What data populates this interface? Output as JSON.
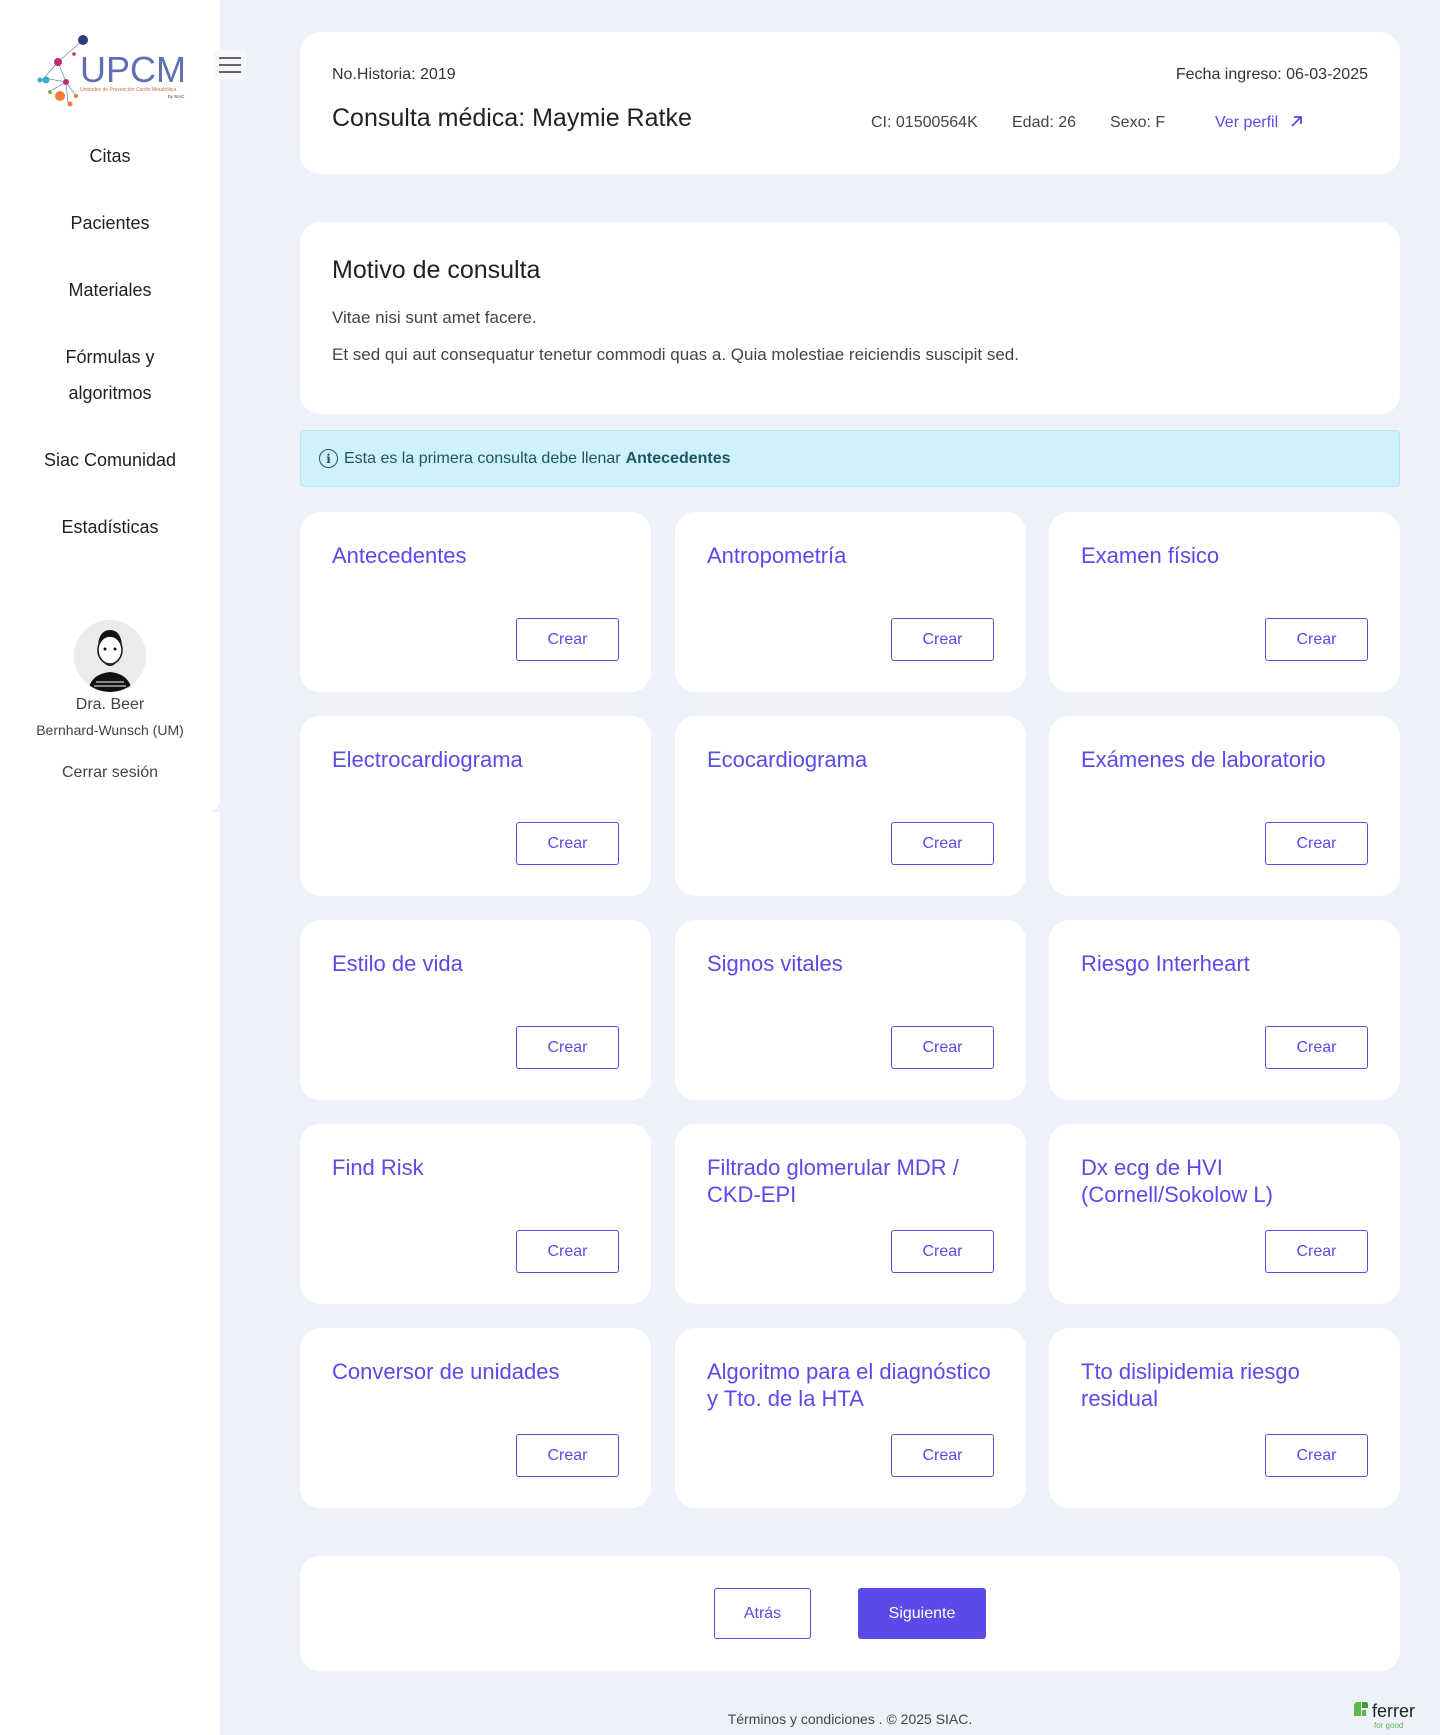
{
  "brand": {
    "logo_text": "UPCM",
    "logo_subtitle": "Unidades de Prevención Cardio Metabólica",
    "logo_tag": "by SIAC"
  },
  "sidebar": {
    "items": [
      {
        "label": "Citas"
      },
      {
        "label": "Pacientes"
      },
      {
        "label": "Materiales"
      },
      {
        "label": "Fórmulas y algoritmos"
      },
      {
        "label": "Siac Comunidad"
      },
      {
        "label": "Estadísticas"
      }
    ],
    "user": {
      "name": "Dra. Beer",
      "org": "Bernhard-Wunsch (UM)",
      "logout": "Cerrar sesión"
    }
  },
  "header": {
    "historia": "No.Historia: 2019",
    "fecha": "Fecha ingreso: 06-03-2025",
    "title": "Consulta médica: Maymie Ratke",
    "ci": "CI: 01500564K",
    "edad": "Edad: 26",
    "sexo": "Sexo: F",
    "ver_perfil": "Ver perfil"
  },
  "motivo": {
    "title": "Motivo de consulta",
    "line1": "Vitae nisi sunt amet facere.",
    "line2": "Et sed qui aut consequatur tenetur commodi quas a. Quia molestiae reiciendis suscipit sed."
  },
  "alert": {
    "text": "Esta es la primera consulta debe llenar",
    "strong": "Antecedentes"
  },
  "modules": [
    {
      "title": "Antecedentes",
      "button": "Crear"
    },
    {
      "title": "Antropometría",
      "button": "Crear"
    },
    {
      "title": "Examen físico",
      "button": "Crear"
    },
    {
      "title": "Electrocardiograma",
      "button": "Crear"
    },
    {
      "title": "Ecocardiograma",
      "button": "Crear"
    },
    {
      "title": "Exámenes de laboratorio",
      "button": "Crear"
    },
    {
      "title": "Estilo de vida",
      "button": "Crear"
    },
    {
      "title": "Signos vitales",
      "button": "Crear"
    },
    {
      "title": "Riesgo Interheart",
      "button": "Crear"
    },
    {
      "title": "Find Risk",
      "button": "Crear"
    },
    {
      "title": "Filtrado glomerular MDR / CKD-EPI",
      "button": "Crear"
    },
    {
      "title": "Dx ecg de HVI (Cornell/Sokolow L)",
      "button": "Crear"
    },
    {
      "title": "Conversor de unidades",
      "button": "Crear"
    },
    {
      "title": "Algoritmo para el diagnóstico y Tto. de la HTA",
      "button": "Crear"
    },
    {
      "title": "Tto dislipidemia riesgo residual",
      "button": "Crear"
    }
  ],
  "footer": {
    "back": "Atrás",
    "next": "Siguiente",
    "terms": "Términos y condiciones . © 2025 SIAC.",
    "partner_logo": "ferrer",
    "partner_tagline": "for good"
  },
  "colors": {
    "accent": "#5a4be8",
    "background": "#eef1fa",
    "alert_bg": "#cff1fb",
    "alert_text": "#1c5563"
  }
}
